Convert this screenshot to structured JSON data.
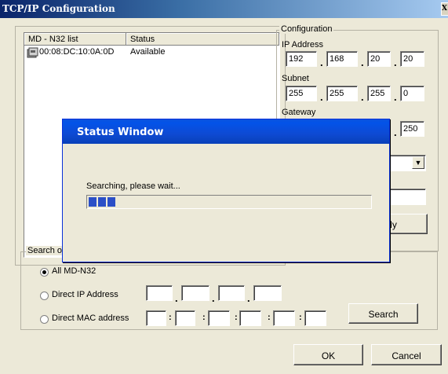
{
  "window": {
    "title": "TCP/IP Configuration",
    "close_glyph": "X"
  },
  "list": {
    "col_name": "MD - N32 list",
    "col_status": "Status",
    "rows": [
      {
        "name": "00:08:DC:10:0A:0D",
        "status": "Available"
      }
    ]
  },
  "config": {
    "group_title": "Configuration",
    "ip_label": "IP Address",
    "ip": [
      "192",
      "168",
      "20",
      "20"
    ],
    "subnet_label": "Subnet",
    "subnet": [
      "255",
      "255",
      "255",
      "0"
    ],
    "gateway_label": "Gateway",
    "gateway_last": "250",
    "apply_partial": "ly"
  },
  "search": {
    "group_title": "Search opti",
    "opt_all": "All MD-N32",
    "opt_ip": "Direct IP Address",
    "opt_mac": "Direct MAC address",
    "selected": "all",
    "button": "Search"
  },
  "buttons": {
    "ok": "OK",
    "cancel": "Cancel"
  },
  "status_window": {
    "title": "Status Window",
    "message": "Searching, please wait...",
    "progress_fraction": 0.1
  }
}
